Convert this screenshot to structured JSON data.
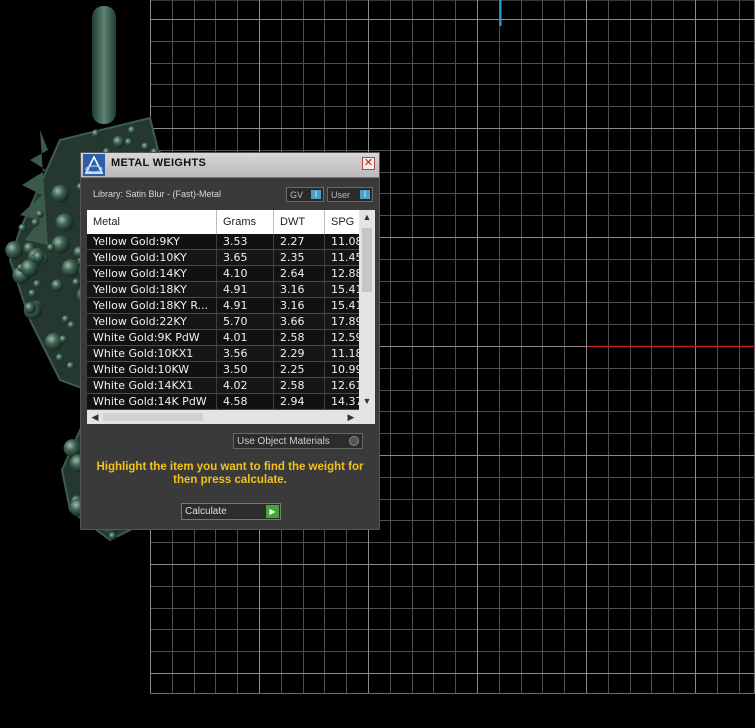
{
  "panel": {
    "title": "METAL WEIGHTS",
    "close_glyph": "✕",
    "library_label": "Library: Satin Blur - (Fast)-Metal",
    "gv_label": "GV",
    "user_label": "User",
    "toggle_glyph": "I",
    "columns": [
      "Metal",
      "Grams",
      "DWT",
      "SPG"
    ],
    "rows": [
      {
        "metal": "Yellow Gold:9KY",
        "grams": "3.53",
        "dwt": "2.27",
        "spg": "11.08"
      },
      {
        "metal": "Yellow Gold:10KY",
        "grams": "3.65",
        "dwt": "2.35",
        "spg": "11.45"
      },
      {
        "metal": "Yellow Gold:14KY",
        "grams": "4.10",
        "dwt": "2.64",
        "spg": "12.88"
      },
      {
        "metal": "Yellow Gold:18KY",
        "grams": "4.91",
        "dwt": "3.16",
        "spg": "15.41"
      },
      {
        "metal": "Yellow Gold:18KY R...",
        "grams": "4.91",
        "dwt": "3.16",
        "spg": "15.41"
      },
      {
        "metal": "Yellow Gold:22KY",
        "grams": "5.70",
        "dwt": "3.66",
        "spg": "17.89"
      },
      {
        "metal": "White Gold:9K PdW",
        "grams": "4.01",
        "dwt": "2.58",
        "spg": "12.59"
      },
      {
        "metal": "White Gold:10KX1",
        "grams": "3.56",
        "dwt": "2.29",
        "spg": "11.18"
      },
      {
        "metal": "White Gold:10KW",
        "grams": "3.50",
        "dwt": "2.25",
        "spg": "10.99"
      },
      {
        "metal": "White Gold:14KX1",
        "grams": "4.02",
        "dwt": "2.58",
        "spg": "12.61"
      },
      {
        "metal": "White Gold:14K PdW",
        "grams": "4.58",
        "dwt": "2.94",
        "spg": "14.37"
      }
    ],
    "use_object_materials_label": "Use Object Materials",
    "instruction": "Highlight the item you want to find the weight for then press calculate.",
    "calculate_label": "Calculate",
    "scroll_up": "▲",
    "scroll_down": "▼",
    "scroll_left": "◀",
    "scroll_right": "▶",
    "go_glyph": "▶"
  },
  "viewport": {
    "icon": "seahorse-pendant-model",
    "x_axis_color": "#c0201f",
    "y_axis_color": "#2a9fd6",
    "grid_color": "#6d6d6d"
  },
  "colors": {
    "instruction": "#f2c21a",
    "model": "#2f4a3e"
  }
}
